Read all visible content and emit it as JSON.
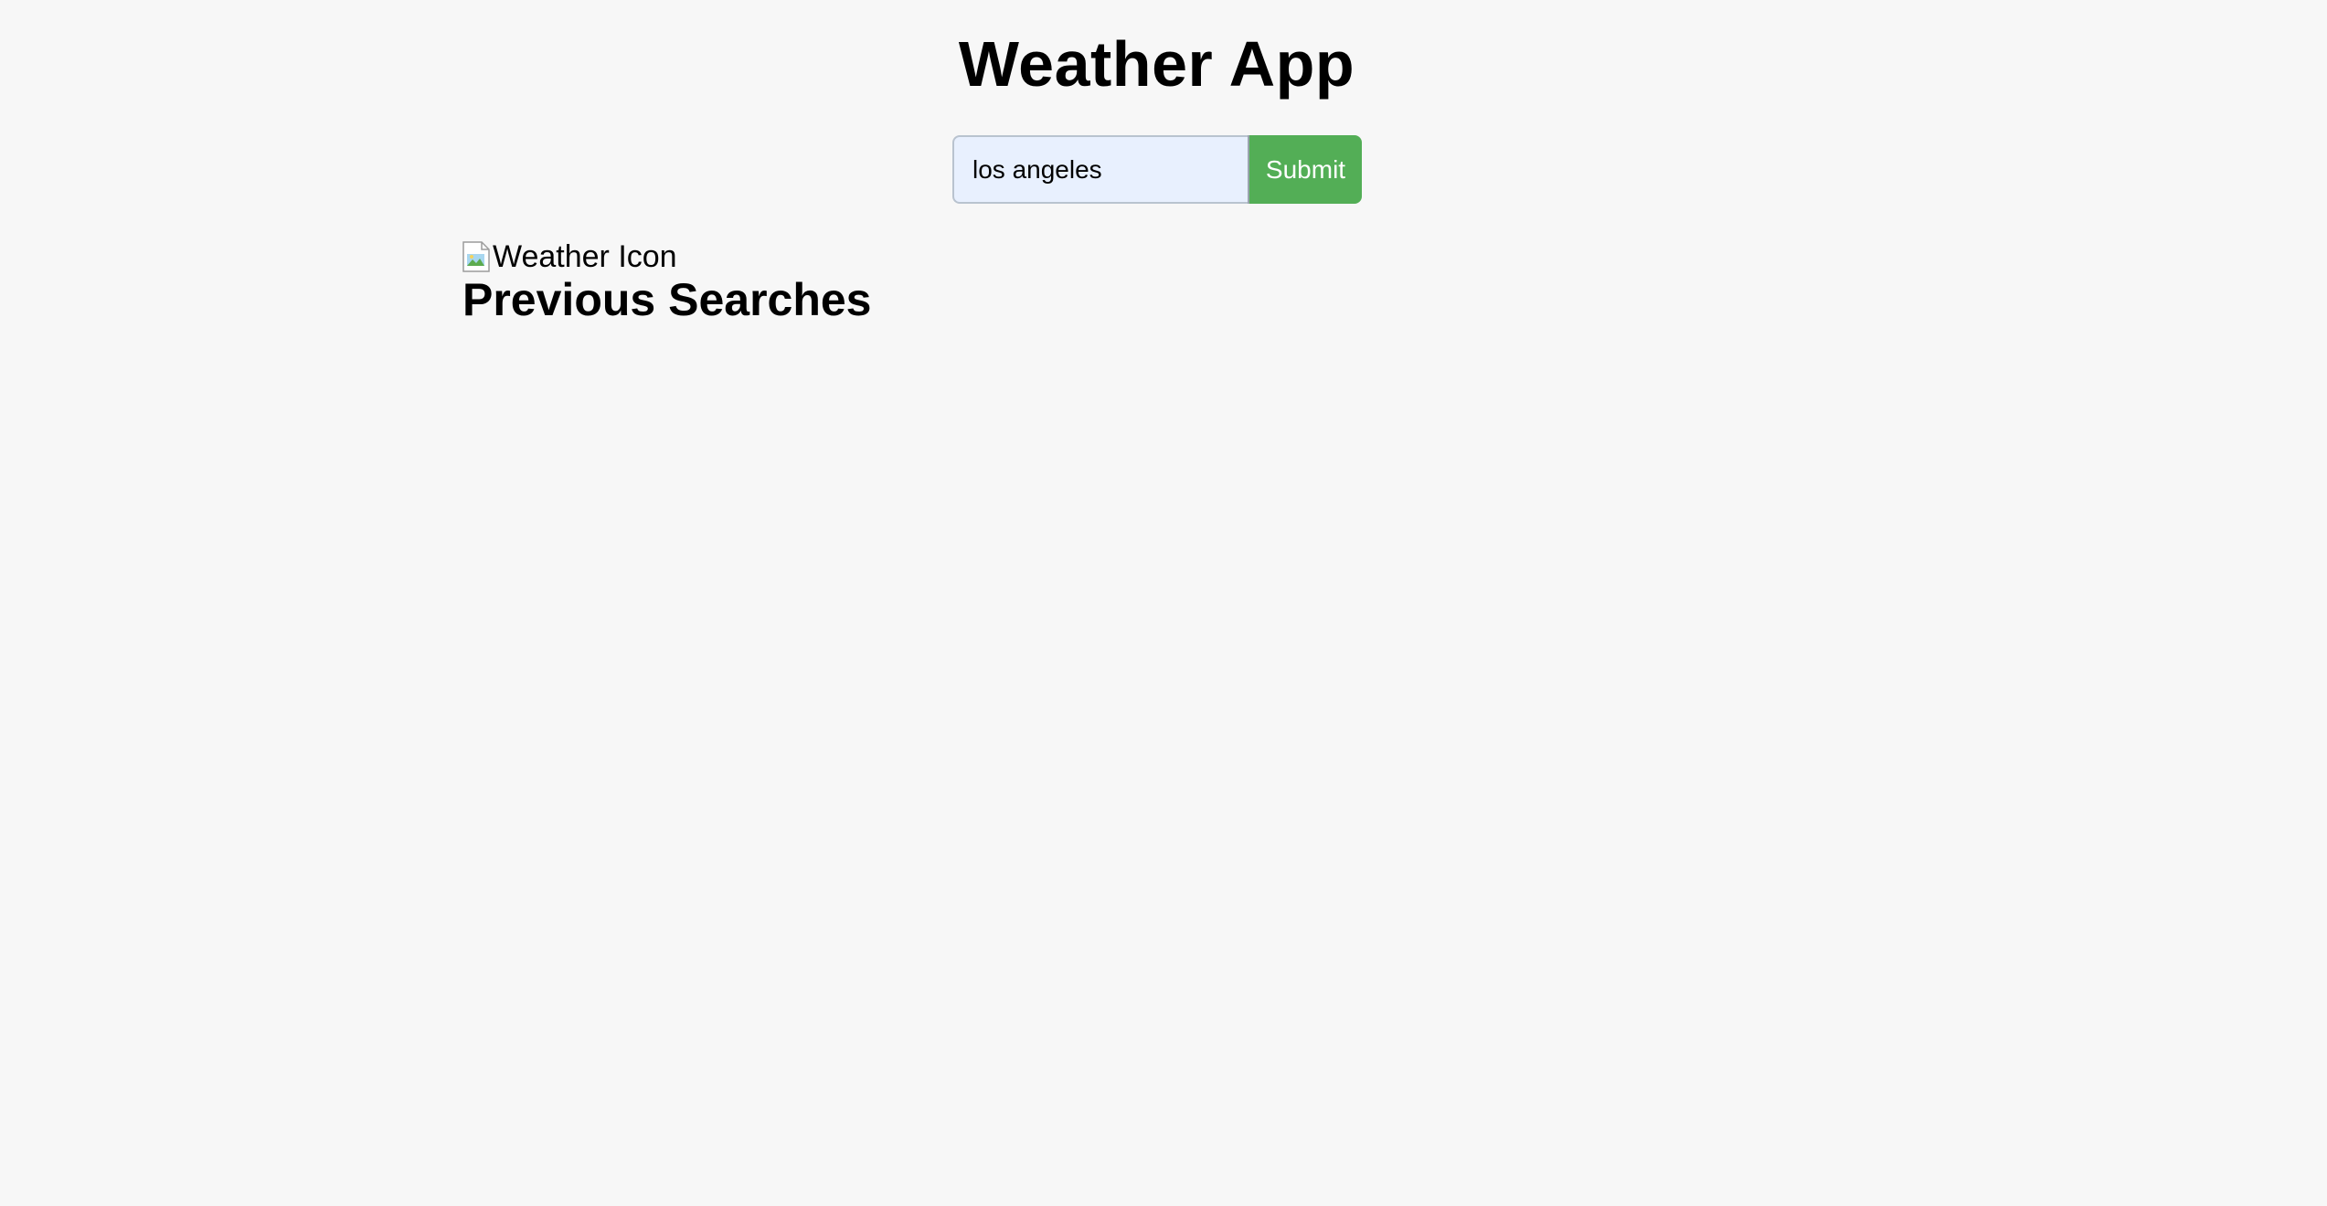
{
  "app": {
    "title": "Weather App"
  },
  "search": {
    "value": "los angeles",
    "submit_label": "Submit"
  },
  "weather": {
    "icon_alt": "Weather Icon",
    "icon_name": "broken-image-icon"
  },
  "history": {
    "heading": "Previous Searches",
    "items": []
  },
  "colors": {
    "background": "#f7f7f7",
    "input_background": "#e8f0fe",
    "submit_background": "#53ae56",
    "submit_text": "#ffffff"
  }
}
